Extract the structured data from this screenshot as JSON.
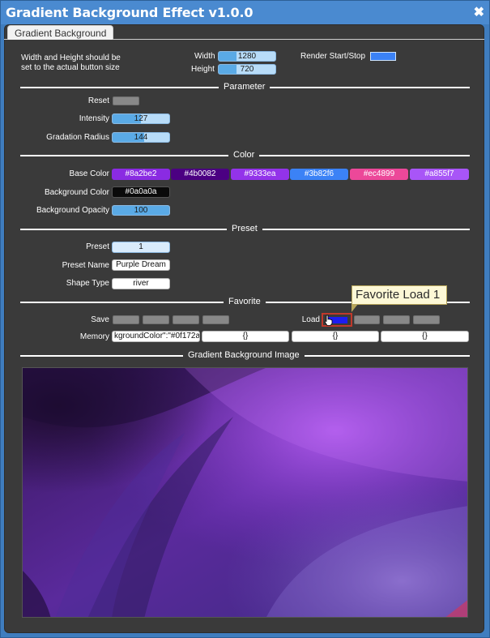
{
  "window": {
    "title": "Gradient Background Effect v1.0.0"
  },
  "tab": {
    "label": "Gradient Background"
  },
  "size": {
    "note_line1": "Width and Height should be",
    "note_line2": "set to the actual button size",
    "width_label": "Width",
    "width_value": "1280",
    "height_label": "Height",
    "height_value": "720"
  },
  "render": {
    "label": "Render Start/Stop"
  },
  "sections": {
    "parameter": "Parameter",
    "color": "Color",
    "preset": "Preset",
    "favorite": "Favorite",
    "image": "Gradient Background Image"
  },
  "parameter": {
    "reset_label": "Reset",
    "intensity_label": "Intensity",
    "intensity_value": "127",
    "intensity_level": 0.5,
    "radius_label": "Gradation Radius",
    "radius_value": "144",
    "radius_level": 0.56
  },
  "color": {
    "base_label": "Base Color",
    "base_colors": [
      {
        "text": "#8a2be2",
        "bg": "#8a2be2"
      },
      {
        "text": "#4b0082",
        "bg": "#4b0082"
      },
      {
        "text": "#9333ea",
        "bg": "#9333ea"
      },
      {
        "text": "#3b82f6",
        "bg": "#3b82f6"
      },
      {
        "text": "#ec4899",
        "bg": "#ec4899"
      },
      {
        "text": "#a855f7",
        "bg": "#a855f7"
      }
    ],
    "bg_label": "Background Color",
    "bg_value": "#0a0a0a",
    "opacity_label": "Background Opacity",
    "opacity_value": "100",
    "opacity_level": 1.0
  },
  "preset": {
    "preset_label": "Preset",
    "preset_value": "1",
    "name_label": "Preset Name",
    "name_value": "Purple Dream",
    "shape_label": "Shape Type",
    "shape_value": "river"
  },
  "favorite": {
    "save_label": "Save",
    "load_label": "Load",
    "memory_label": "Memory",
    "memory_values": [
      "kgroundColor\":\"#0f172a",
      "{}",
      "{}",
      "{}"
    ],
    "tooltip": "Favorite Load 1"
  }
}
